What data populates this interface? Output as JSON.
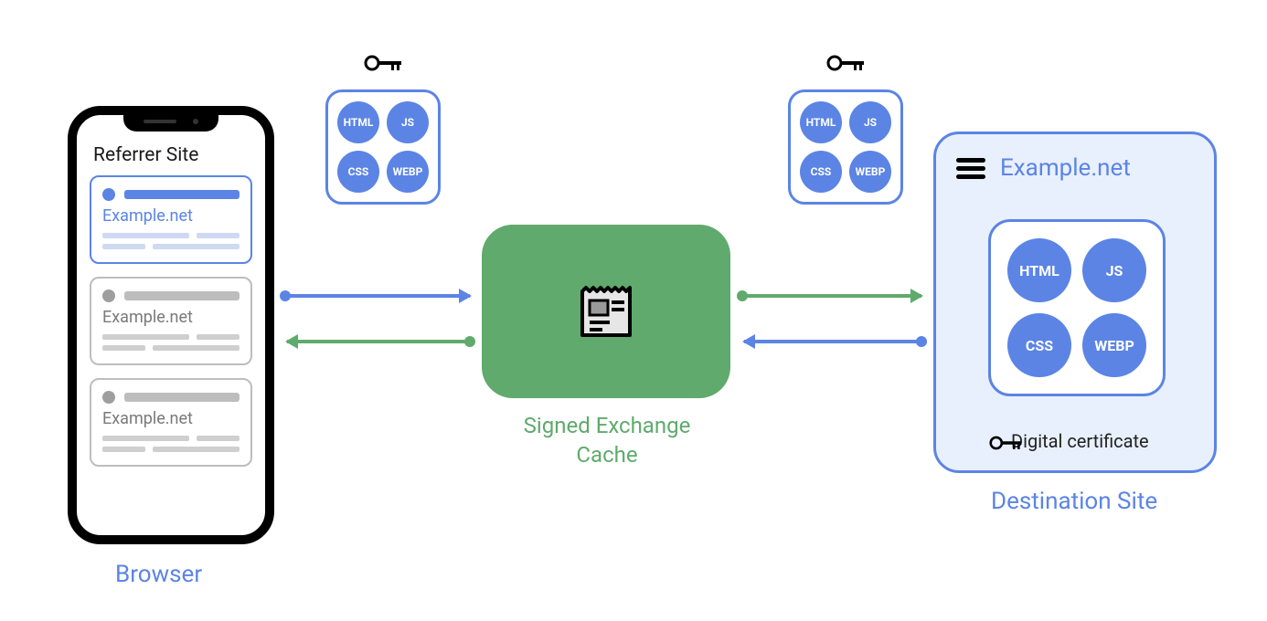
{
  "browser": {
    "label": "Browser",
    "referrer_site": "Referrer Site",
    "cards": [
      {
        "site": "Example.net",
        "active": true
      },
      {
        "site": "Example.net",
        "active": false
      },
      {
        "site": "Example.net",
        "active": false
      }
    ]
  },
  "cache": {
    "label": "Signed Exchange Cache"
  },
  "destination": {
    "label": "Destination Site",
    "title": "Example.net",
    "certificate_label": "Digital certificate"
  },
  "assets": {
    "items": [
      "HTML",
      "JS",
      "CSS",
      "WEBP"
    ]
  },
  "colors": {
    "blue": "#5b84e5",
    "green": "#5faa6c",
    "lightblue": "#e9f0fd"
  }
}
